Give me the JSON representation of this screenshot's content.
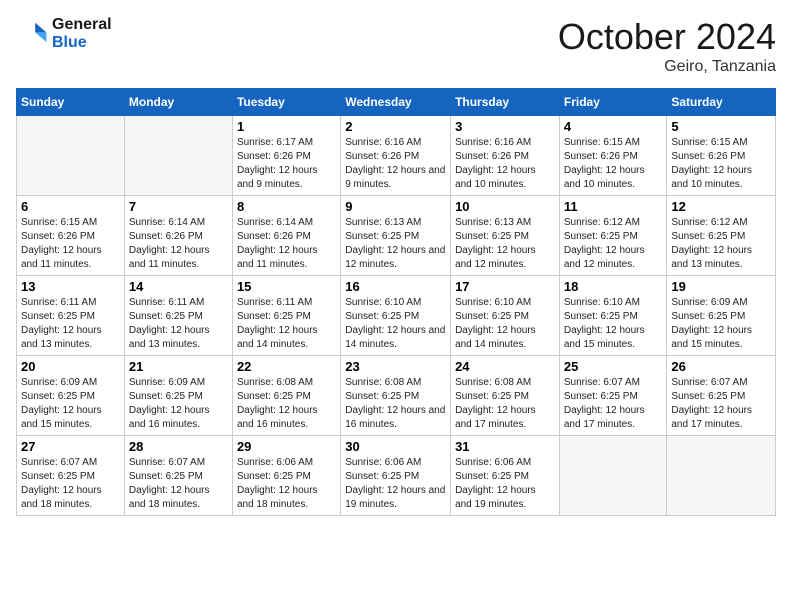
{
  "header": {
    "logo_line1": "General",
    "logo_line2": "Blue",
    "month_title": "October 2024",
    "location": "Geiro, Tanzania"
  },
  "days_of_week": [
    "Sunday",
    "Monday",
    "Tuesday",
    "Wednesday",
    "Thursday",
    "Friday",
    "Saturday"
  ],
  "weeks": [
    [
      {
        "day": "",
        "sunrise": "",
        "sunset": "",
        "daylight": "",
        "empty": true
      },
      {
        "day": "",
        "sunrise": "",
        "sunset": "",
        "daylight": "",
        "empty": true
      },
      {
        "day": "1",
        "sunrise": "Sunrise: 6:17 AM",
        "sunset": "Sunset: 6:26 PM",
        "daylight": "Daylight: 12 hours and 9 minutes."
      },
      {
        "day": "2",
        "sunrise": "Sunrise: 6:16 AM",
        "sunset": "Sunset: 6:26 PM",
        "daylight": "Daylight: 12 hours and 9 minutes."
      },
      {
        "day": "3",
        "sunrise": "Sunrise: 6:16 AM",
        "sunset": "Sunset: 6:26 PM",
        "daylight": "Daylight: 12 hours and 10 minutes."
      },
      {
        "day": "4",
        "sunrise": "Sunrise: 6:15 AM",
        "sunset": "Sunset: 6:26 PM",
        "daylight": "Daylight: 12 hours and 10 minutes."
      },
      {
        "day": "5",
        "sunrise": "Sunrise: 6:15 AM",
        "sunset": "Sunset: 6:26 PM",
        "daylight": "Daylight: 12 hours and 10 minutes."
      }
    ],
    [
      {
        "day": "6",
        "sunrise": "Sunrise: 6:15 AM",
        "sunset": "Sunset: 6:26 PM",
        "daylight": "Daylight: 12 hours and 11 minutes."
      },
      {
        "day": "7",
        "sunrise": "Sunrise: 6:14 AM",
        "sunset": "Sunset: 6:26 PM",
        "daylight": "Daylight: 12 hours and 11 minutes."
      },
      {
        "day": "8",
        "sunrise": "Sunrise: 6:14 AM",
        "sunset": "Sunset: 6:26 PM",
        "daylight": "Daylight: 12 hours and 11 minutes."
      },
      {
        "day": "9",
        "sunrise": "Sunrise: 6:13 AM",
        "sunset": "Sunset: 6:25 PM",
        "daylight": "Daylight: 12 hours and 12 minutes."
      },
      {
        "day": "10",
        "sunrise": "Sunrise: 6:13 AM",
        "sunset": "Sunset: 6:25 PM",
        "daylight": "Daylight: 12 hours and 12 minutes."
      },
      {
        "day": "11",
        "sunrise": "Sunrise: 6:12 AM",
        "sunset": "Sunset: 6:25 PM",
        "daylight": "Daylight: 12 hours and 12 minutes."
      },
      {
        "day": "12",
        "sunrise": "Sunrise: 6:12 AM",
        "sunset": "Sunset: 6:25 PM",
        "daylight": "Daylight: 12 hours and 13 minutes."
      }
    ],
    [
      {
        "day": "13",
        "sunrise": "Sunrise: 6:11 AM",
        "sunset": "Sunset: 6:25 PM",
        "daylight": "Daylight: 12 hours and 13 minutes."
      },
      {
        "day": "14",
        "sunrise": "Sunrise: 6:11 AM",
        "sunset": "Sunset: 6:25 PM",
        "daylight": "Daylight: 12 hours and 13 minutes."
      },
      {
        "day": "15",
        "sunrise": "Sunrise: 6:11 AM",
        "sunset": "Sunset: 6:25 PM",
        "daylight": "Daylight: 12 hours and 14 minutes."
      },
      {
        "day": "16",
        "sunrise": "Sunrise: 6:10 AM",
        "sunset": "Sunset: 6:25 PM",
        "daylight": "Daylight: 12 hours and 14 minutes."
      },
      {
        "day": "17",
        "sunrise": "Sunrise: 6:10 AM",
        "sunset": "Sunset: 6:25 PM",
        "daylight": "Daylight: 12 hours and 14 minutes."
      },
      {
        "day": "18",
        "sunrise": "Sunrise: 6:10 AM",
        "sunset": "Sunset: 6:25 PM",
        "daylight": "Daylight: 12 hours and 15 minutes."
      },
      {
        "day": "19",
        "sunrise": "Sunrise: 6:09 AM",
        "sunset": "Sunset: 6:25 PM",
        "daylight": "Daylight: 12 hours and 15 minutes."
      }
    ],
    [
      {
        "day": "20",
        "sunrise": "Sunrise: 6:09 AM",
        "sunset": "Sunset: 6:25 PM",
        "daylight": "Daylight: 12 hours and 15 minutes."
      },
      {
        "day": "21",
        "sunrise": "Sunrise: 6:09 AM",
        "sunset": "Sunset: 6:25 PM",
        "daylight": "Daylight: 12 hours and 16 minutes."
      },
      {
        "day": "22",
        "sunrise": "Sunrise: 6:08 AM",
        "sunset": "Sunset: 6:25 PM",
        "daylight": "Daylight: 12 hours and 16 minutes."
      },
      {
        "day": "23",
        "sunrise": "Sunrise: 6:08 AM",
        "sunset": "Sunset: 6:25 PM",
        "daylight": "Daylight: 12 hours and 16 minutes."
      },
      {
        "day": "24",
        "sunrise": "Sunrise: 6:08 AM",
        "sunset": "Sunset: 6:25 PM",
        "daylight": "Daylight: 12 hours and 17 minutes."
      },
      {
        "day": "25",
        "sunrise": "Sunrise: 6:07 AM",
        "sunset": "Sunset: 6:25 PM",
        "daylight": "Daylight: 12 hours and 17 minutes."
      },
      {
        "day": "26",
        "sunrise": "Sunrise: 6:07 AM",
        "sunset": "Sunset: 6:25 PM",
        "daylight": "Daylight: 12 hours and 17 minutes."
      }
    ],
    [
      {
        "day": "27",
        "sunrise": "Sunrise: 6:07 AM",
        "sunset": "Sunset: 6:25 PM",
        "daylight": "Daylight: 12 hours and 18 minutes."
      },
      {
        "day": "28",
        "sunrise": "Sunrise: 6:07 AM",
        "sunset": "Sunset: 6:25 PM",
        "daylight": "Daylight: 12 hours and 18 minutes."
      },
      {
        "day": "29",
        "sunrise": "Sunrise: 6:06 AM",
        "sunset": "Sunset: 6:25 PM",
        "daylight": "Daylight: 12 hours and 18 minutes."
      },
      {
        "day": "30",
        "sunrise": "Sunrise: 6:06 AM",
        "sunset": "Sunset: 6:25 PM",
        "daylight": "Daylight: 12 hours and 19 minutes."
      },
      {
        "day": "31",
        "sunrise": "Sunrise: 6:06 AM",
        "sunset": "Sunset: 6:25 PM",
        "daylight": "Daylight: 12 hours and 19 minutes."
      },
      {
        "day": "",
        "sunrise": "",
        "sunset": "",
        "daylight": "",
        "empty": true
      },
      {
        "day": "",
        "sunrise": "",
        "sunset": "",
        "daylight": "",
        "empty": true
      }
    ]
  ]
}
